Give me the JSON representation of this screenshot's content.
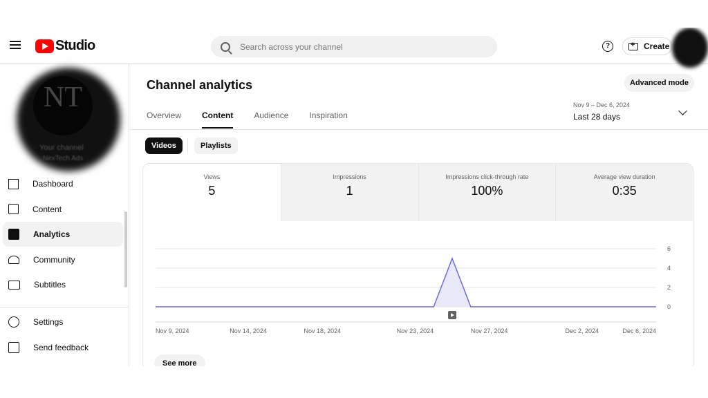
{
  "topbar": {
    "app_name": "Studio",
    "search_placeholder": "Search across your channel",
    "help_label": "?",
    "create_label": "Create"
  },
  "sidebar": {
    "channel_logo_text": "NT",
    "channel_label": "Your channel",
    "channel_name": "NexTech Ads",
    "items": [
      {
        "label": "Dashboard",
        "icon": "dashboard-icon"
      },
      {
        "label": "Content",
        "icon": "content-icon"
      },
      {
        "label": "Analytics",
        "icon": "analytics-icon",
        "active": true
      },
      {
        "label": "Community",
        "icon": "community-icon"
      },
      {
        "label": "Subtitles",
        "icon": "subtitles-icon"
      }
    ],
    "bottom_items": [
      {
        "label": "Settings",
        "icon": "gear-icon"
      },
      {
        "label": "Send feedback",
        "icon": "feedback-icon"
      }
    ]
  },
  "main": {
    "title": "Channel analytics",
    "advanced_label": "Advanced mode",
    "tabs": [
      "Overview",
      "Content",
      "Audience",
      "Inspiration"
    ],
    "active_tab": "Content",
    "date_range": {
      "dates": "Nov 9 – Dec 6, 2024",
      "label": "Last 28 days"
    },
    "chips": [
      "Videos",
      "Playlists"
    ],
    "metrics": [
      {
        "label": "Views",
        "value": "5"
      },
      {
        "label": "Impressions",
        "value": "1"
      },
      {
        "label": "Impressions click-through rate",
        "value": "100%"
      },
      {
        "label": "Average view duration",
        "value": "0:35"
      }
    ],
    "see_more_label": "See more"
  },
  "chart_data": {
    "type": "area",
    "title": "",
    "xlabel": "",
    "ylabel": "",
    "x_tick_labels": [
      "Nov 9, 2024",
      "Nov 14, 2024",
      "Nov 18, 2024",
      "Nov 23, 2024",
      "Nov 27, 2024",
      "Dec 2, 2024",
      "Dec 6, 2024"
    ],
    "y_ticks": [
      0,
      2,
      4,
      6
    ],
    "ylim": [
      0,
      6
    ],
    "x": [
      "Nov 9, 2024",
      "Nov 24, 2024",
      "Nov 25, 2024",
      "Nov 26, 2024",
      "Dec 6, 2024"
    ],
    "values": [
      0,
      0,
      5,
      0,
      0
    ],
    "series_color": "#6b6bd6",
    "fill_color": "#e8e8f8",
    "grid": true,
    "marker_icon": "video-marker-icon"
  }
}
